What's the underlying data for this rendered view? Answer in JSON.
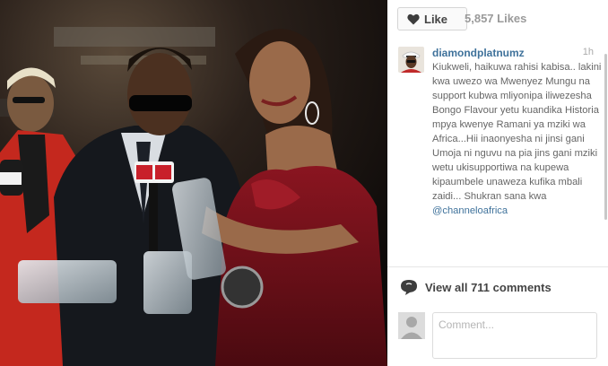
{
  "post": {
    "image_alt": "Diamond Platnumz holding Channel O awards with a presenter in a red dress"
  },
  "actions": {
    "like_label": "Like",
    "likes_count": "5,857 Likes"
  },
  "caption": {
    "username": "diamondplatnumz",
    "time": "1h",
    "text": "Kiukweli, haikuwa rahisi kabisa.. lakini kwa uwezo wa Mwenyez Mungu na support kubwa mliyonipa iliwezesha Bongo Flavour yetu kuandika Historia mpya kwenye Ramani ya mziki wa Africa...Hii inaonyesha ni jinsi gani Umoja ni nguvu na pia jins gani mziki wetu ukisupportiwa na kupewa kipaumbele unaweza kufika mbali zaidi... Shukran sana kwa",
    "mention": "@channeloafrica"
  },
  "comments": {
    "view_all_label": "View all 711 comments",
    "input_placeholder": "Comment..."
  },
  "colors": {
    "link_blue": "#3f729b",
    "muted_text": "#666666"
  },
  "icons": {
    "like": "heart-icon",
    "comments": "speech-bubble-icon",
    "user": "default-avatar-icon"
  }
}
